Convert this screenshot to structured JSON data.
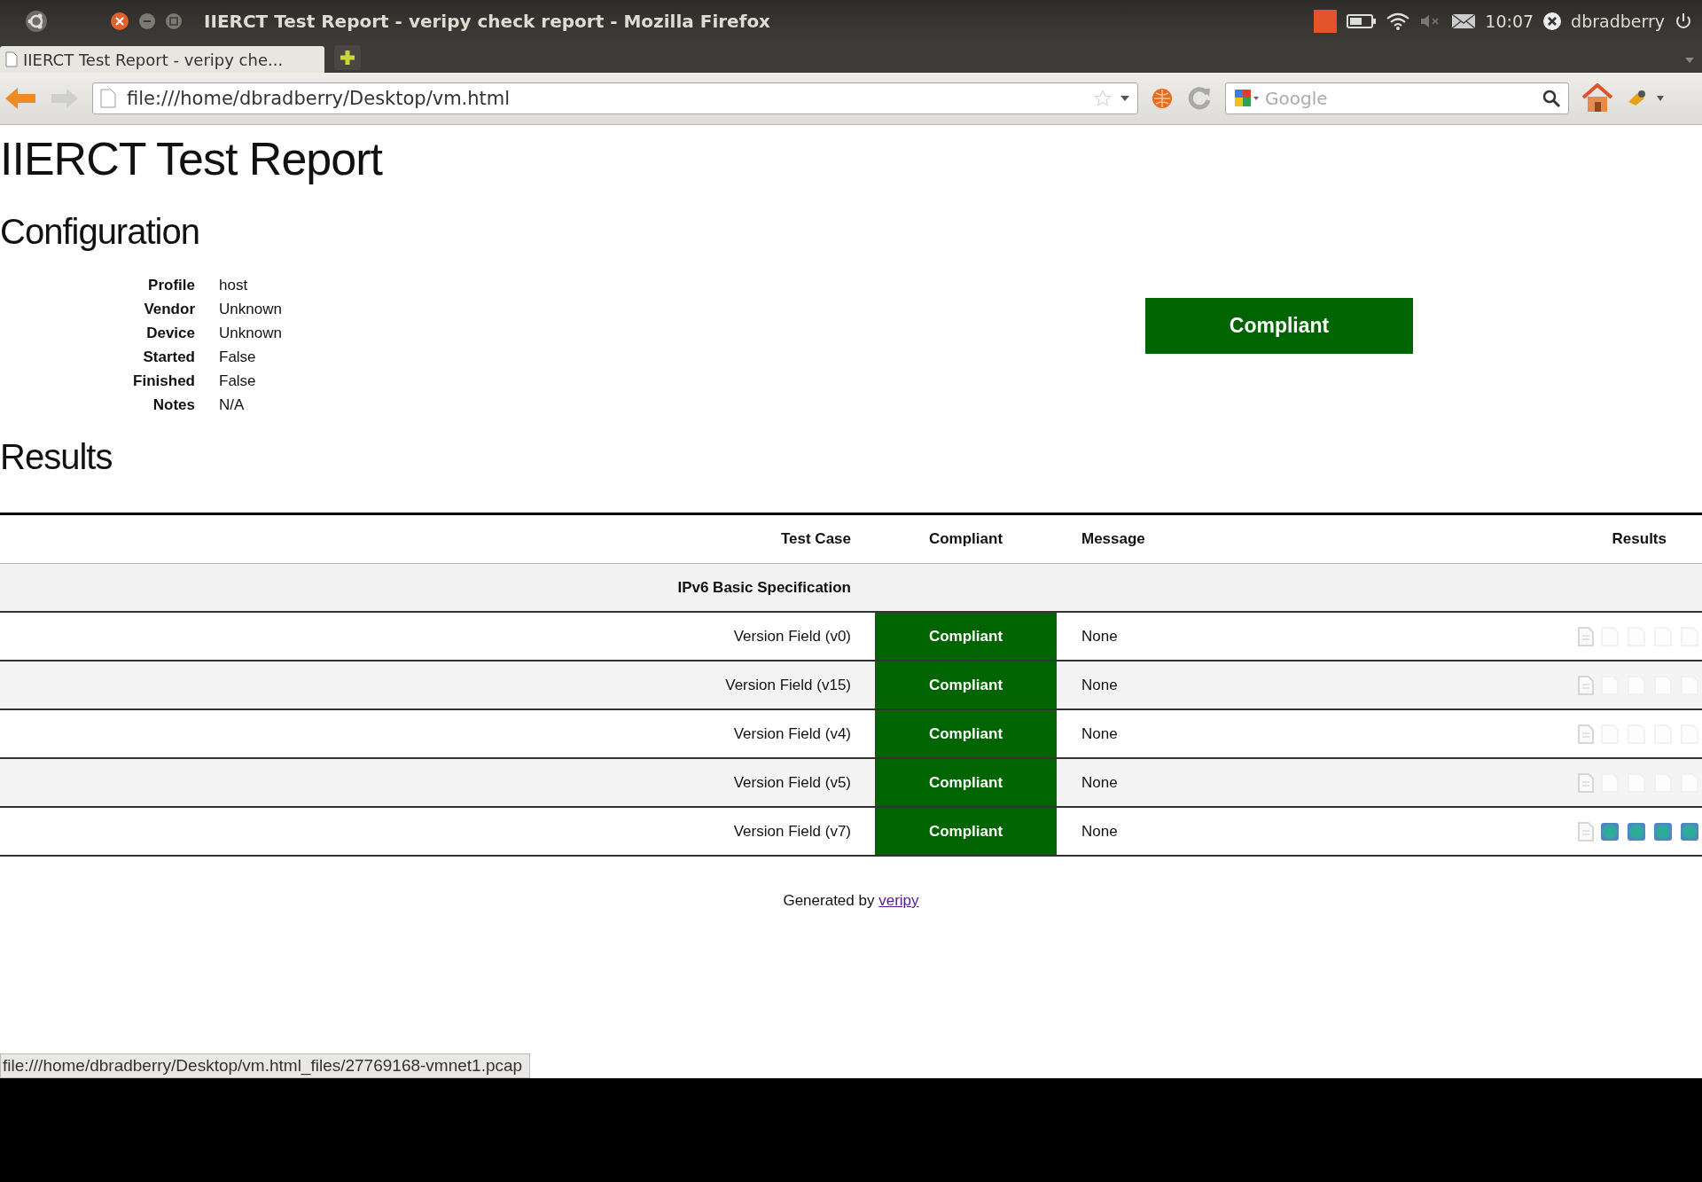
{
  "top_panel": {
    "window_title": "IIERCT Test Report - veripy check report - Mozilla Firefox",
    "clock": "10:07",
    "user": "dbradberry"
  },
  "tabs": [
    {
      "label": "IIERCT Test Report - veripy che...",
      "selected": true
    }
  ],
  "address_bar": {
    "value": "file:///home/dbradberry/Desktop/vm.html"
  },
  "search": {
    "placeholder": "Google"
  },
  "page": {
    "title": "IIERCT Test Report",
    "configuration": {
      "heading": "Configuration",
      "fields": [
        {
          "label": "Profile",
          "value": "host"
        },
        {
          "label": "Vendor",
          "value": "Unknown"
        },
        {
          "label": "Device",
          "value": "Unknown"
        },
        {
          "label": "Started",
          "value": "False"
        },
        {
          "label": "Finished",
          "value": "False"
        },
        {
          "label": "Notes",
          "value": "N/A"
        }
      ]
    },
    "overall": {
      "label": "Compliant",
      "passed": true
    },
    "results": {
      "heading": "Results",
      "columns": [
        "Test Case",
        "Compliant",
        "Message",
        "Results"
      ],
      "groups": [
        {
          "name": "IPv6 Basic Specification",
          "rows": [
            {
              "test_case": "Version Field (v0)",
              "compliant": "Compliant",
              "passed": true,
              "message": "None",
              "captures_available": false
            },
            {
              "test_case": "Version Field (v15)",
              "compliant": "Compliant",
              "passed": true,
              "message": "None",
              "captures_available": false
            },
            {
              "test_case": "Version Field (v4)",
              "compliant": "Compliant",
              "passed": true,
              "message": "None",
              "captures_available": false
            },
            {
              "test_case": "Version Field (v5)",
              "compliant": "Compliant",
              "passed": true,
              "message": "None",
              "captures_available": false
            },
            {
              "test_case": "Version Field (v7)",
              "compliant": "Compliant",
              "passed": true,
              "message": "None",
              "captures_available": true
            }
          ]
        }
      ]
    },
    "footer": {
      "text": "Generated by",
      "link": "veripy"
    }
  },
  "status_bar": {
    "text": "file:///home/dbradberry/Desktop/vm.html_files/27769168-vmnet1.pcap"
  }
}
